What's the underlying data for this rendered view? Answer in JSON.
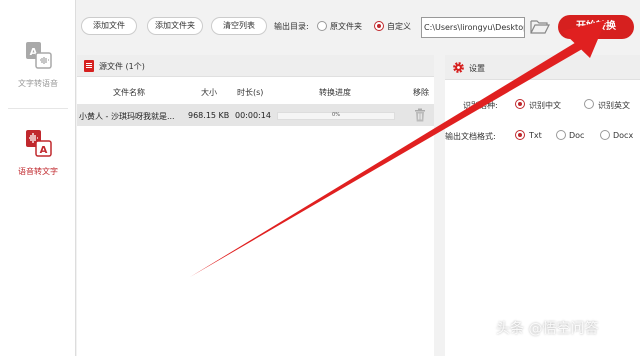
{
  "sidebar": {
    "items": [
      {
        "label": "文字转语音",
        "active": false
      },
      {
        "label": "语音转文字",
        "active": true
      }
    ]
  },
  "toolbar": {
    "add_file": "添加文件",
    "add_folder": "添加文件夹",
    "clear_list": "清空列表",
    "output_label": "输出目录:",
    "opt_source": "原文件夹",
    "opt_custom": "自定义",
    "output_path": "C:\\Users\\lirongyu\\Desktop",
    "start": "开始转换"
  },
  "file_panel": {
    "title": "源文件 (1个)",
    "columns": [
      "文件名称",
      "大小",
      "时长(s)",
      "转换进度",
      "移除"
    ],
    "rows": [
      {
        "name": "小黄人 - 沙琪玛呀我就是...",
        "size": "968.15 KB",
        "duration": "00:00:14",
        "progress_text": "0%",
        "progress": 0
      }
    ]
  },
  "settings": {
    "title": "设置",
    "lang_label": "识别语种:",
    "lang_options": [
      "识别中文",
      "识别英文"
    ],
    "lang_selected": "识别中文",
    "format_label": "输出文档格式:",
    "format_options": [
      "Txt",
      "Doc",
      "Docx"
    ],
    "format_selected": "Txt"
  },
  "colors": {
    "accent": "#d6201f",
    "arrow": "#e02020"
  },
  "watermark": "头条 @悟空问答"
}
